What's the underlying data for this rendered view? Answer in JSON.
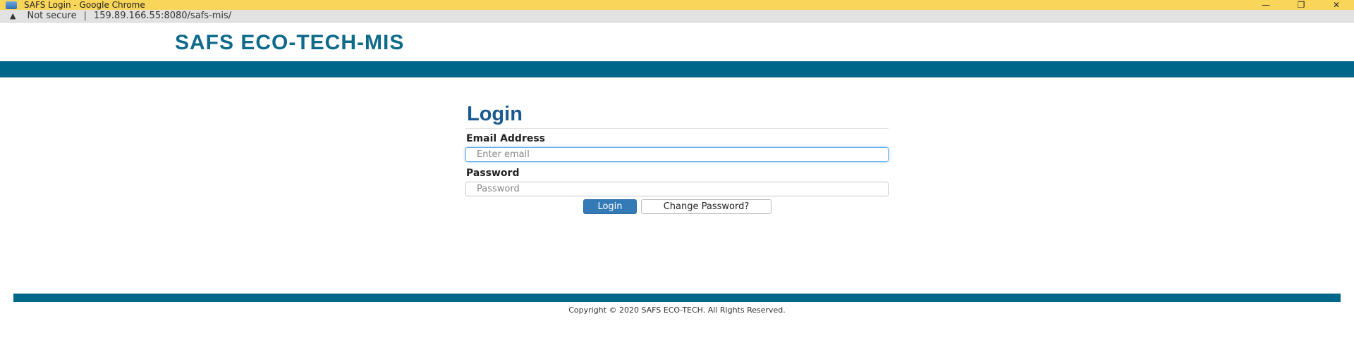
{
  "window": {
    "title": "SAFS Login - Google Chrome",
    "controls": {
      "minimize": "—",
      "restore": "❐",
      "close": "✕"
    }
  },
  "addressbar": {
    "security_icon": "warning-triangle-icon",
    "security_text": "Not secure",
    "separator": "|",
    "url": "159.89.166.55:8080/safs-mis/"
  },
  "header": {
    "brand": "SAFS ECO-TECH-MIS",
    "band_color": "#01678a"
  },
  "login": {
    "title": "Login",
    "email_label": "Email Address",
    "email_placeholder": "Enter email",
    "email_value": "",
    "password_label": "Password",
    "password_placeholder": "Password",
    "password_value": "",
    "login_button": "Login",
    "change_password_button": "Change Password?"
  },
  "colors": {
    "brand": "#0e6a8b",
    "title": "#1a5a8e",
    "primary_button": "#337ab7",
    "titlebar": "#f9d65a"
  },
  "footer": {
    "copyright": "Copyright © 2020 SAFS ECO-TECH. All Rights Reserved."
  }
}
